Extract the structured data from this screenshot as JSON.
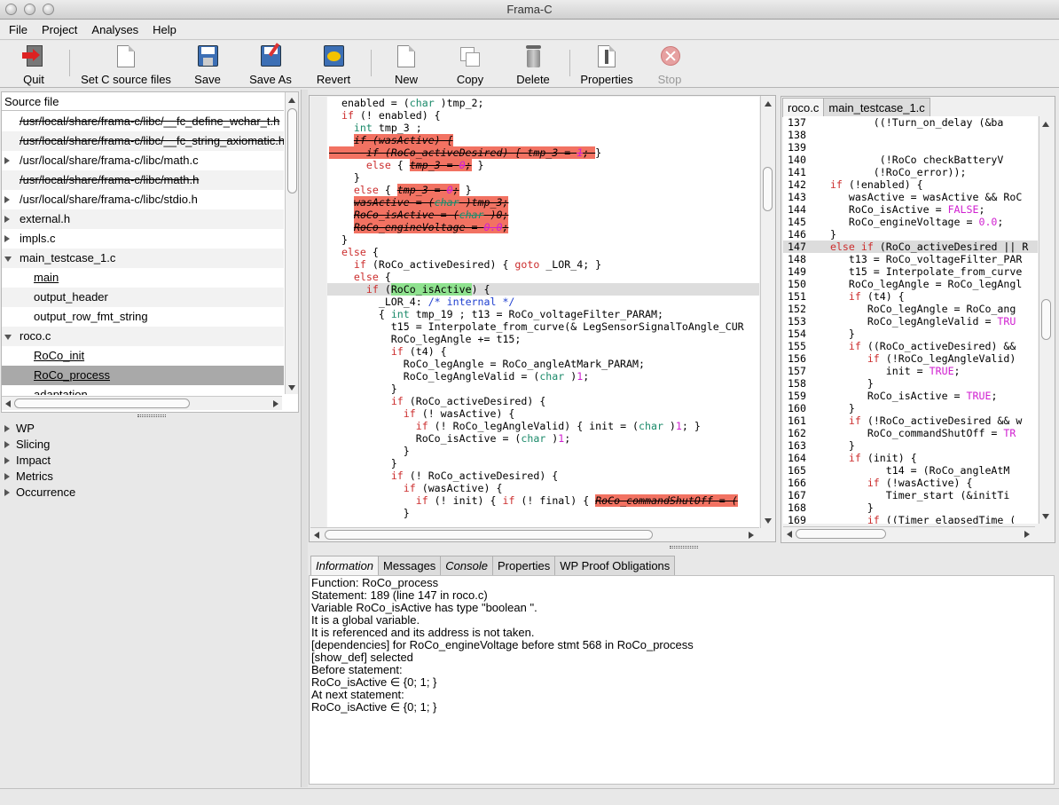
{
  "window": {
    "title": "Frama-C"
  },
  "menu": [
    "File",
    "Project",
    "Analyses",
    "Help"
  ],
  "toolbar": {
    "quit": "Quit",
    "set_sources": "Set C source files",
    "save": "Save",
    "save_as": "Save As",
    "revert": "Revert",
    "new": "New",
    "copy": "Copy",
    "delete": "Delete",
    "properties": "Properties",
    "stop": "Stop"
  },
  "source_panel": {
    "header": "Source file",
    "items": [
      {
        "label": "/usr/local/share/frama-c/libc/__fc_define_wchar_t.h",
        "strike": true,
        "expand": "",
        "indent": 0
      },
      {
        "label": "/usr/local/share/frama-c/libc/__fc_string_axiomatic.h",
        "strike": true,
        "expand": "",
        "indent": 0
      },
      {
        "label": "/usr/local/share/frama-c/libc/math.c",
        "strike": false,
        "expand": "r",
        "indent": 0
      },
      {
        "label": "/usr/local/share/frama-c/libc/math.h",
        "strike": true,
        "expand": "",
        "indent": 0
      },
      {
        "label": "/usr/local/share/frama-c/libc/stdio.h",
        "strike": false,
        "expand": "r",
        "indent": 0
      },
      {
        "label": "external.h",
        "strike": false,
        "expand": "r",
        "indent": 0
      },
      {
        "label": "impls.c",
        "strike": false,
        "expand": "r",
        "indent": 0
      },
      {
        "label": "main_testcase_1.c",
        "strike": false,
        "expand": "d",
        "indent": 0
      },
      {
        "label": "main",
        "strike": false,
        "expand": "",
        "indent": 1,
        "under": true
      },
      {
        "label": "output_header",
        "strike": false,
        "expand": "",
        "indent": 1
      },
      {
        "label": "output_row_fmt_string",
        "strike": false,
        "expand": "",
        "indent": 1
      },
      {
        "label": "roco.c",
        "strike": false,
        "expand": "d",
        "indent": 0
      },
      {
        "label": "RoCo_init",
        "strike": false,
        "expand": "",
        "indent": 1,
        "under": true
      },
      {
        "label": "RoCo_process",
        "strike": false,
        "expand": "",
        "indent": 1,
        "under": true,
        "sel": true
      },
      {
        "label": "adaptation",
        "strike": false,
        "expand": "",
        "indent": 1
      }
    ]
  },
  "plugins": [
    "WP",
    "Slicing",
    "Impact",
    "Metrics",
    "Occurrence"
  ],
  "code_lines": [
    [
      [
        "  enabled = (",
        ""
      ],
      [
        "char",
        "ty"
      ],
      [
        " )tmp_2;",
        ""
      ]
    ],
    [
      [
        "  ",
        ""
      ],
      [
        "if",
        "kw"
      ],
      [
        " (! enabled) {",
        ""
      ]
    ],
    [
      [
        "    ",
        ""
      ],
      [
        "int",
        "ty"
      ],
      [
        " tmp_3 ;",
        ""
      ]
    ],
    [
      [
        "    ",
        ""
      ],
      [
        "if (wasActive) {",
        "dead"
      ]
    ],
    [
      [
        "",
        ""
      ],
      [
        "      if (RoCo_activeDesired) { tmp_3 = ",
        "dead"
      ],
      [
        "1",
        "deadnm"
      ],
      [
        "; ",
        "dead"
      ],
      [
        "}",
        ""
      ]
    ],
    [
      [
        "      ",
        ""
      ],
      [
        "else",
        "kw"
      ],
      [
        " { ",
        ""
      ],
      [
        "tmp_3 = ",
        "dead"
      ],
      [
        "0",
        "deadnm"
      ],
      [
        ";",
        "dead"
      ],
      [
        " }",
        ""
      ]
    ],
    [
      [
        "    }",
        ""
      ]
    ],
    [
      [
        "    ",
        ""
      ],
      [
        "else",
        "kw"
      ],
      [
        " { ",
        ""
      ],
      [
        "tmp_3 = ",
        "dead"
      ],
      [
        "0",
        "deadnm"
      ],
      [
        ";",
        "dead"
      ],
      [
        " }",
        ""
      ]
    ],
    [
      [
        "    ",
        ""
      ],
      [
        "wasActive = (",
        "dead"
      ],
      [
        "char",
        "deadty"
      ],
      [
        " )tmp_3;",
        "dead"
      ]
    ],
    [
      [
        "    ",
        ""
      ],
      [
        "RoCo_isActive = (",
        "dead"
      ],
      [
        "char",
        "deadty"
      ],
      [
        " )0;",
        "dead"
      ]
    ],
    [
      [
        "    ",
        ""
      ],
      [
        "RoCo_engineVoltage = ",
        "dead"
      ],
      [
        "0.0",
        "deadnm"
      ],
      [
        ";",
        "dead"
      ]
    ],
    [
      [
        "  }",
        ""
      ]
    ],
    [
      [
        "  ",
        ""
      ],
      [
        "else",
        "kw"
      ],
      [
        " {",
        ""
      ]
    ],
    [
      [
        "    ",
        ""
      ],
      [
        "if",
        "kw"
      ],
      [
        " (RoCo_activeDesired) { ",
        ""
      ],
      [
        "goto",
        "kw"
      ],
      [
        " _LOR_4; }",
        ""
      ]
    ],
    [
      [
        "    ",
        ""
      ],
      [
        "else",
        "kw"
      ],
      [
        " {",
        ""
      ]
    ],
    [
      [
        "      ",
        ""
      ],
      [
        "if",
        "kw"
      ],
      [
        " (",
        ""
      ],
      [
        "RoCo_isActive",
        "gr"
      ],
      [
        ") {",
        ""
      ]
    ],
    [
      [
        "        _LOR_4: ",
        ""
      ],
      [
        "/* internal */",
        "cm"
      ]
    ],
    [
      [
        "        { ",
        ""
      ],
      [
        "int",
        "ty"
      ],
      [
        " tmp_19 ; t13 = RoCo_voltageFilter_PARAM;",
        ""
      ]
    ],
    [
      [
        "          t15 = Interpolate_from_curve(& LegSensorSignalToAngle_CUR",
        ""
      ]
    ],
    [
      [
        "          RoCo_legAngle += t15;",
        ""
      ]
    ],
    [
      [
        "          ",
        ""
      ],
      [
        "if",
        "kw"
      ],
      [
        " (t4) {",
        ""
      ]
    ],
    [
      [
        "            RoCo_legAngle = RoCo_angleAtMark_PARAM;",
        ""
      ]
    ],
    [
      [
        "            RoCo_legAngleValid = (",
        ""
      ],
      [
        "char",
        "ty"
      ],
      [
        " )",
        ""
      ],
      [
        "1",
        "nm"
      ],
      [
        ";",
        ""
      ]
    ],
    [
      [
        "          }",
        ""
      ]
    ],
    [
      [
        "          ",
        ""
      ],
      [
        "if",
        "kw"
      ],
      [
        " (RoCo_activeDesired) {",
        ""
      ]
    ],
    [
      [
        "            ",
        ""
      ],
      [
        "if",
        "kw"
      ],
      [
        " (! wasActive) {",
        ""
      ]
    ],
    [
      [
        "              ",
        ""
      ],
      [
        "if",
        "kw"
      ],
      [
        " (! RoCo_legAngleValid) { init = (",
        ""
      ],
      [
        "char",
        "ty"
      ],
      [
        " )",
        ""
      ],
      [
        "1",
        "nm"
      ],
      [
        "; }",
        ""
      ]
    ],
    [
      [
        "              RoCo_isActive = (",
        ""
      ],
      [
        "char",
        "ty"
      ],
      [
        " )",
        ""
      ],
      [
        "1",
        "nm"
      ],
      [
        ";",
        ""
      ]
    ],
    [
      [
        "            }",
        ""
      ]
    ],
    [
      [
        "          }",
        ""
      ]
    ],
    [
      [
        "          ",
        ""
      ],
      [
        "if",
        "kw"
      ],
      [
        " (! RoCo_activeDesired) {",
        ""
      ]
    ],
    [
      [
        "            ",
        ""
      ],
      [
        "if",
        "kw"
      ],
      [
        " (wasActive) {",
        ""
      ]
    ],
    [
      [
        "              ",
        ""
      ],
      [
        "if",
        "kw"
      ],
      [
        " (! init) { ",
        ""
      ],
      [
        "if",
        "kw"
      ],
      [
        " (! final) { ",
        ""
      ],
      [
        "RoCo_commandShutOff = (",
        "dead"
      ]
    ],
    [
      [
        "            }",
        ""
      ]
    ],
    [
      [
        "",
        ""
      ]
    ]
  ],
  "file_tabs": [
    "roco.c",
    "main_testcase_1.c"
  ],
  "listing": [
    [
      "137",
      "          ((!Turn_on_delay (&ba"
    ],
    [
      "138",
      ""
    ],
    [
      "139",
      ""
    ],
    [
      "140",
      "           (!RoCo checkBatteryV"
    ],
    [
      "141",
      "          (!RoCo_error));"
    ],
    [
      "142",
      "   if (!enabled) {"
    ],
    [
      "143",
      "      wasActive = wasActive && RoC"
    ],
    [
      "144",
      "      RoCo_isActive = FALSE;"
    ],
    [
      "145",
      "      RoCo_engineVoltage = 0.0;"
    ],
    [
      "146",
      "   }"
    ],
    [
      "147",
      "   else if (RoCo_activeDesired || R"
    ],
    [
      "148",
      "      t13 = RoCo_voltageFilter_PAR"
    ],
    [
      "149",
      "      t15 = Interpolate_from_curve"
    ],
    [
      "150",
      "      RoCo_legAngle = RoCo_legAngl"
    ],
    [
      "151",
      "      if (t4) {"
    ],
    [
      "152",
      "         RoCo_legAngle = RoCo_ang"
    ],
    [
      "153",
      "         RoCo_legAngleValid = TRU"
    ],
    [
      "154",
      "      }"
    ],
    [
      "155",
      "      if ((RoCo_activeDesired) &&"
    ],
    [
      "156",
      "         if (!RoCo_legAngleValid)"
    ],
    [
      "157",
      "            init = TRUE;"
    ],
    [
      "158",
      "         }"
    ],
    [
      "159",
      "         RoCo_isActive = TRUE;"
    ],
    [
      "160",
      "      }"
    ],
    [
      "161",
      "      if (!RoCo_activeDesired && w"
    ],
    [
      "162",
      "         RoCo_commandShutOff = TR"
    ],
    [
      "163",
      "      }"
    ],
    [
      "164",
      "      if (init) {"
    ],
    [
      "165",
      "            t14 = (RoCo_angleAtM"
    ],
    [
      "166",
      "         if (!wasActive) {"
    ],
    [
      "167",
      "            Timer_start (&initTi"
    ],
    [
      "168",
      "         }"
    ],
    [
      "169",
      "         if ((Timer_elapsedTime ("
    ]
  ],
  "bottom_tabs": [
    "Information",
    "Messages",
    "Console",
    "Properties",
    "WP Proof Obligations"
  ],
  "info_lines": [
    "Function: RoCo_process",
    "Statement: 189 (line 147 in roco.c)",
    "Variable RoCo_isActive has type \"boolean \".",
    "It is a global variable.",
    "It is referenced and its address is not taken.",
    "[dependencies] for RoCo_engineVoltage before stmt 568 in RoCo_process",
    "[show_def] selected",
    "Before statement:",
    "RoCo_isActive ∈ {0; 1; }",
    "At next statement:",
    "RoCo_isActive ∈ {0; 1; }"
  ],
  "colors": {
    "dead": "#f27262",
    "keyword": "#cc2e2e",
    "type": "#1b8a6a",
    "comment": "#1f3fcf",
    "number": "#d020d0",
    "highlight": "#8fe28f",
    "selection": "#a9a9a9"
  }
}
